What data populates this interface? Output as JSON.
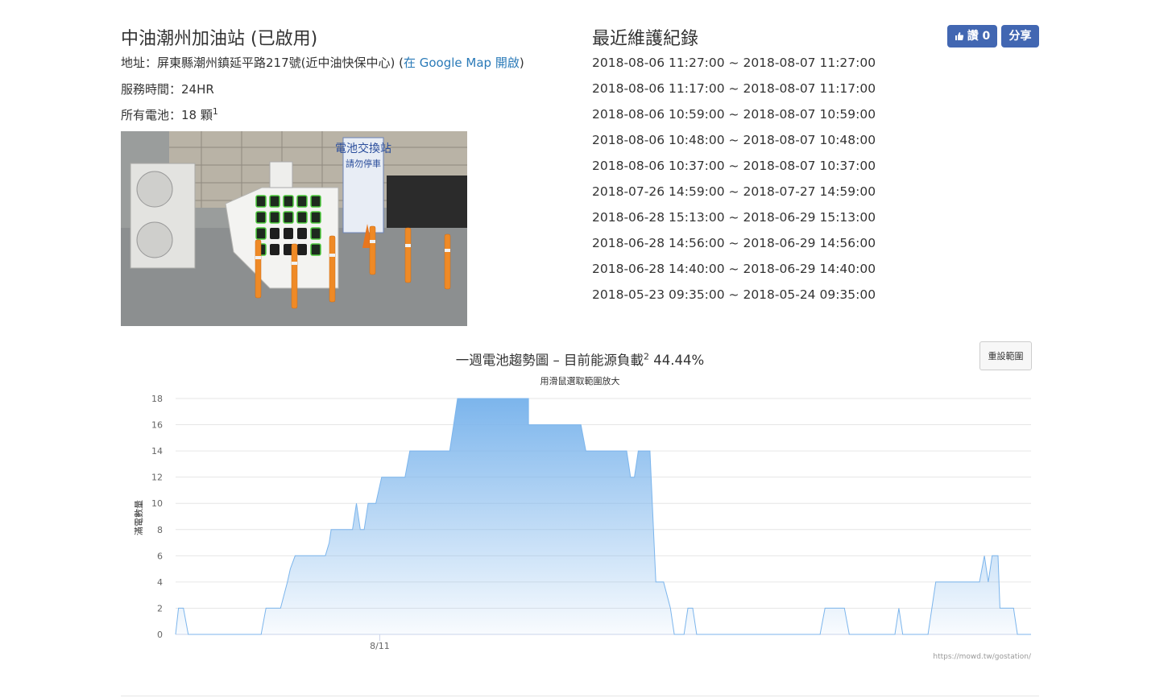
{
  "station": {
    "title": "中油潮州加油站 (已啟用)",
    "address_prefix": "地址：屏東縣潮州鎮延平路217號(近中油快保中心) (",
    "map_link": "在 Google Map 開啟",
    "address_suffix": ")",
    "hours": "服務時間：24HR",
    "batteries": "所有電池：18 顆",
    "batteries_note": "1"
  },
  "maintenance": {
    "title": "最近維護紀錄",
    "records": [
      "2018-08-06 11:27:00 ~ 2018-08-07 11:27:00",
      "2018-08-06 11:17:00 ~ 2018-08-07 11:17:00",
      "2018-08-06 10:59:00 ~ 2018-08-07 10:59:00",
      "2018-08-06 10:48:00 ~ 2018-08-07 10:48:00",
      "2018-08-06 10:37:00 ~ 2018-08-07 10:37:00",
      "2018-07-26 14:59:00 ~ 2018-07-27 14:59:00",
      "2018-06-28 15:13:00 ~ 2018-06-29 15:13:00",
      "2018-06-28 14:56:00 ~ 2018-06-29 14:56:00",
      "2018-06-28 14:40:00 ~ 2018-06-29 14:40:00",
      "2018-05-23 09:35:00 ~ 2018-05-24 09:35:00"
    ]
  },
  "social": {
    "like_label": "讚 0",
    "share_label": "分享",
    "brand_color": "#4267b2"
  },
  "photo": {
    "sign_text": "電池交換站 請勿停車",
    "sign_line1": "電池交換站",
    "sign_line2": "請勿停車"
  },
  "chart": {
    "title": "一週電池趨勢圖 – 目前能源負載",
    "title_note": "2",
    "load": "44.44%",
    "subtitle": "用滑鼠選取範圍放大",
    "reset_label": "重設範圍",
    "credit": "https://mowd.tw/gostation/",
    "fill_top_color": "#7cb5ec",
    "line_color": "#7cb5ec"
  },
  "chart_data": {
    "type": "area",
    "title": "一週電池趨勢圖 – 目前能源負載 44.44%",
    "subtitle": "用滑鼠選取範圍放大",
    "xlabel": "",
    "ylabel": "滿電數量",
    "ylim": [
      0,
      18
    ],
    "yticks": [
      0,
      2,
      4,
      6,
      8,
      10,
      12,
      14,
      16,
      18
    ],
    "xtick_labels": [
      {
        "x": 21,
        "label": "8/11"
      }
    ],
    "xlim": [
      0,
      88
    ],
    "grid": true,
    "series": [
      {
        "values": [
          [
            0,
            0
          ],
          [
            0.3,
            2
          ],
          [
            0.8,
            2
          ],
          [
            1.3,
            0
          ],
          [
            8.8,
            0
          ],
          [
            9.3,
            2
          ],
          [
            10.8,
            2
          ],
          [
            11.5,
            4
          ],
          [
            11.8,
            5
          ],
          [
            12.3,
            6
          ],
          [
            15.4,
            6
          ],
          [
            15.8,
            7
          ],
          [
            16,
            8
          ],
          [
            18.2,
            8
          ],
          [
            18.6,
            10
          ],
          [
            19,
            8
          ],
          [
            19.4,
            8
          ],
          [
            19.8,
            10
          ],
          [
            20.6,
            10
          ],
          [
            21.2,
            12
          ],
          [
            23.6,
            12
          ],
          [
            24.1,
            14
          ],
          [
            28.2,
            14
          ],
          [
            28.6,
            16
          ],
          [
            29,
            18
          ],
          [
            36.3,
            18
          ],
          [
            36.3,
            16
          ],
          [
            41.7,
            16
          ],
          [
            42.2,
            14
          ],
          [
            46.4,
            14
          ],
          [
            46.8,
            12
          ],
          [
            47.2,
            12
          ],
          [
            47.6,
            14
          ],
          [
            48.8,
            14
          ],
          [
            49.4,
            4
          ],
          [
            50.2,
            4
          ],
          [
            50.9,
            2
          ],
          [
            51.3,
            0
          ],
          [
            52.3,
            0
          ],
          [
            52.7,
            2
          ],
          [
            53.2,
            2
          ],
          [
            53.6,
            0
          ],
          [
            66.3,
            0
          ],
          [
            66.8,
            2
          ],
          [
            68.8,
            2
          ],
          [
            69.3,
            0
          ],
          [
            74,
            0
          ],
          [
            74.4,
            2
          ],
          [
            74.8,
            0
          ],
          [
            77.4,
            0
          ],
          [
            78.2,
            4
          ],
          [
            82.7,
            4
          ],
          [
            83.2,
            6
          ],
          [
            83.6,
            4
          ],
          [
            84,
            6
          ],
          [
            84.6,
            6
          ],
          [
            84.8,
            2
          ],
          [
            86.2,
            2
          ],
          [
            86.6,
            0
          ],
          [
            88,
            0
          ]
        ]
      }
    ]
  }
}
